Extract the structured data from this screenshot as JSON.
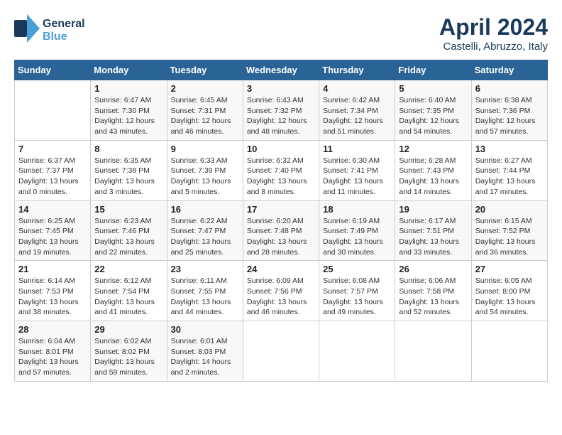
{
  "header": {
    "logo_line1": "General",
    "logo_line2": "Blue",
    "title": "April 2024",
    "location": "Castelli, Abruzzo, Italy"
  },
  "days_of_week": [
    "Sunday",
    "Monday",
    "Tuesday",
    "Wednesday",
    "Thursday",
    "Friday",
    "Saturday"
  ],
  "weeks": [
    [
      {
        "day": "",
        "info": ""
      },
      {
        "day": "1",
        "info": "Sunrise: 6:47 AM\nSunset: 7:30 PM\nDaylight: 12 hours\nand 43 minutes."
      },
      {
        "day": "2",
        "info": "Sunrise: 6:45 AM\nSunset: 7:31 PM\nDaylight: 12 hours\nand 46 minutes."
      },
      {
        "day": "3",
        "info": "Sunrise: 6:43 AM\nSunset: 7:32 PM\nDaylight: 12 hours\nand 48 minutes."
      },
      {
        "day": "4",
        "info": "Sunrise: 6:42 AM\nSunset: 7:34 PM\nDaylight: 12 hours\nand 51 minutes."
      },
      {
        "day": "5",
        "info": "Sunrise: 6:40 AM\nSunset: 7:35 PM\nDaylight: 12 hours\nand 54 minutes."
      },
      {
        "day": "6",
        "info": "Sunrise: 6:38 AM\nSunset: 7:36 PM\nDaylight: 12 hours\nand 57 minutes."
      }
    ],
    [
      {
        "day": "7",
        "info": "Sunrise: 6:37 AM\nSunset: 7:37 PM\nDaylight: 13 hours\nand 0 minutes."
      },
      {
        "day": "8",
        "info": "Sunrise: 6:35 AM\nSunset: 7:38 PM\nDaylight: 13 hours\nand 3 minutes."
      },
      {
        "day": "9",
        "info": "Sunrise: 6:33 AM\nSunset: 7:39 PM\nDaylight: 13 hours\nand 5 minutes."
      },
      {
        "day": "10",
        "info": "Sunrise: 6:32 AM\nSunset: 7:40 PM\nDaylight: 13 hours\nand 8 minutes."
      },
      {
        "day": "11",
        "info": "Sunrise: 6:30 AM\nSunset: 7:41 PM\nDaylight: 13 hours\nand 11 minutes."
      },
      {
        "day": "12",
        "info": "Sunrise: 6:28 AM\nSunset: 7:43 PM\nDaylight: 13 hours\nand 14 minutes."
      },
      {
        "day": "13",
        "info": "Sunrise: 6:27 AM\nSunset: 7:44 PM\nDaylight: 13 hours\nand 17 minutes."
      }
    ],
    [
      {
        "day": "14",
        "info": "Sunrise: 6:25 AM\nSunset: 7:45 PM\nDaylight: 13 hours\nand 19 minutes."
      },
      {
        "day": "15",
        "info": "Sunrise: 6:23 AM\nSunset: 7:46 PM\nDaylight: 13 hours\nand 22 minutes."
      },
      {
        "day": "16",
        "info": "Sunrise: 6:22 AM\nSunset: 7:47 PM\nDaylight: 13 hours\nand 25 minutes."
      },
      {
        "day": "17",
        "info": "Sunrise: 6:20 AM\nSunset: 7:48 PM\nDaylight: 13 hours\nand 28 minutes."
      },
      {
        "day": "18",
        "info": "Sunrise: 6:19 AM\nSunset: 7:49 PM\nDaylight: 13 hours\nand 30 minutes."
      },
      {
        "day": "19",
        "info": "Sunrise: 6:17 AM\nSunset: 7:51 PM\nDaylight: 13 hours\nand 33 minutes."
      },
      {
        "day": "20",
        "info": "Sunrise: 6:15 AM\nSunset: 7:52 PM\nDaylight: 13 hours\nand 36 minutes."
      }
    ],
    [
      {
        "day": "21",
        "info": "Sunrise: 6:14 AM\nSunset: 7:53 PM\nDaylight: 13 hours\nand 38 minutes."
      },
      {
        "day": "22",
        "info": "Sunrise: 6:12 AM\nSunset: 7:54 PM\nDaylight: 13 hours\nand 41 minutes."
      },
      {
        "day": "23",
        "info": "Sunrise: 6:11 AM\nSunset: 7:55 PM\nDaylight: 13 hours\nand 44 minutes."
      },
      {
        "day": "24",
        "info": "Sunrise: 6:09 AM\nSunset: 7:56 PM\nDaylight: 13 hours\nand 46 minutes."
      },
      {
        "day": "25",
        "info": "Sunrise: 6:08 AM\nSunset: 7:57 PM\nDaylight: 13 hours\nand 49 minutes."
      },
      {
        "day": "26",
        "info": "Sunrise: 6:06 AM\nSunset: 7:58 PM\nDaylight: 13 hours\nand 52 minutes."
      },
      {
        "day": "27",
        "info": "Sunrise: 6:05 AM\nSunset: 8:00 PM\nDaylight: 13 hours\nand 54 minutes."
      }
    ],
    [
      {
        "day": "28",
        "info": "Sunrise: 6:04 AM\nSunset: 8:01 PM\nDaylight: 13 hours\nand 57 minutes."
      },
      {
        "day": "29",
        "info": "Sunrise: 6:02 AM\nSunset: 8:02 PM\nDaylight: 13 hours\nand 59 minutes."
      },
      {
        "day": "30",
        "info": "Sunrise: 6:01 AM\nSunset: 8:03 PM\nDaylight: 14 hours\nand 2 minutes."
      },
      {
        "day": "",
        "info": ""
      },
      {
        "day": "",
        "info": ""
      },
      {
        "day": "",
        "info": ""
      },
      {
        "day": "",
        "info": ""
      }
    ]
  ]
}
